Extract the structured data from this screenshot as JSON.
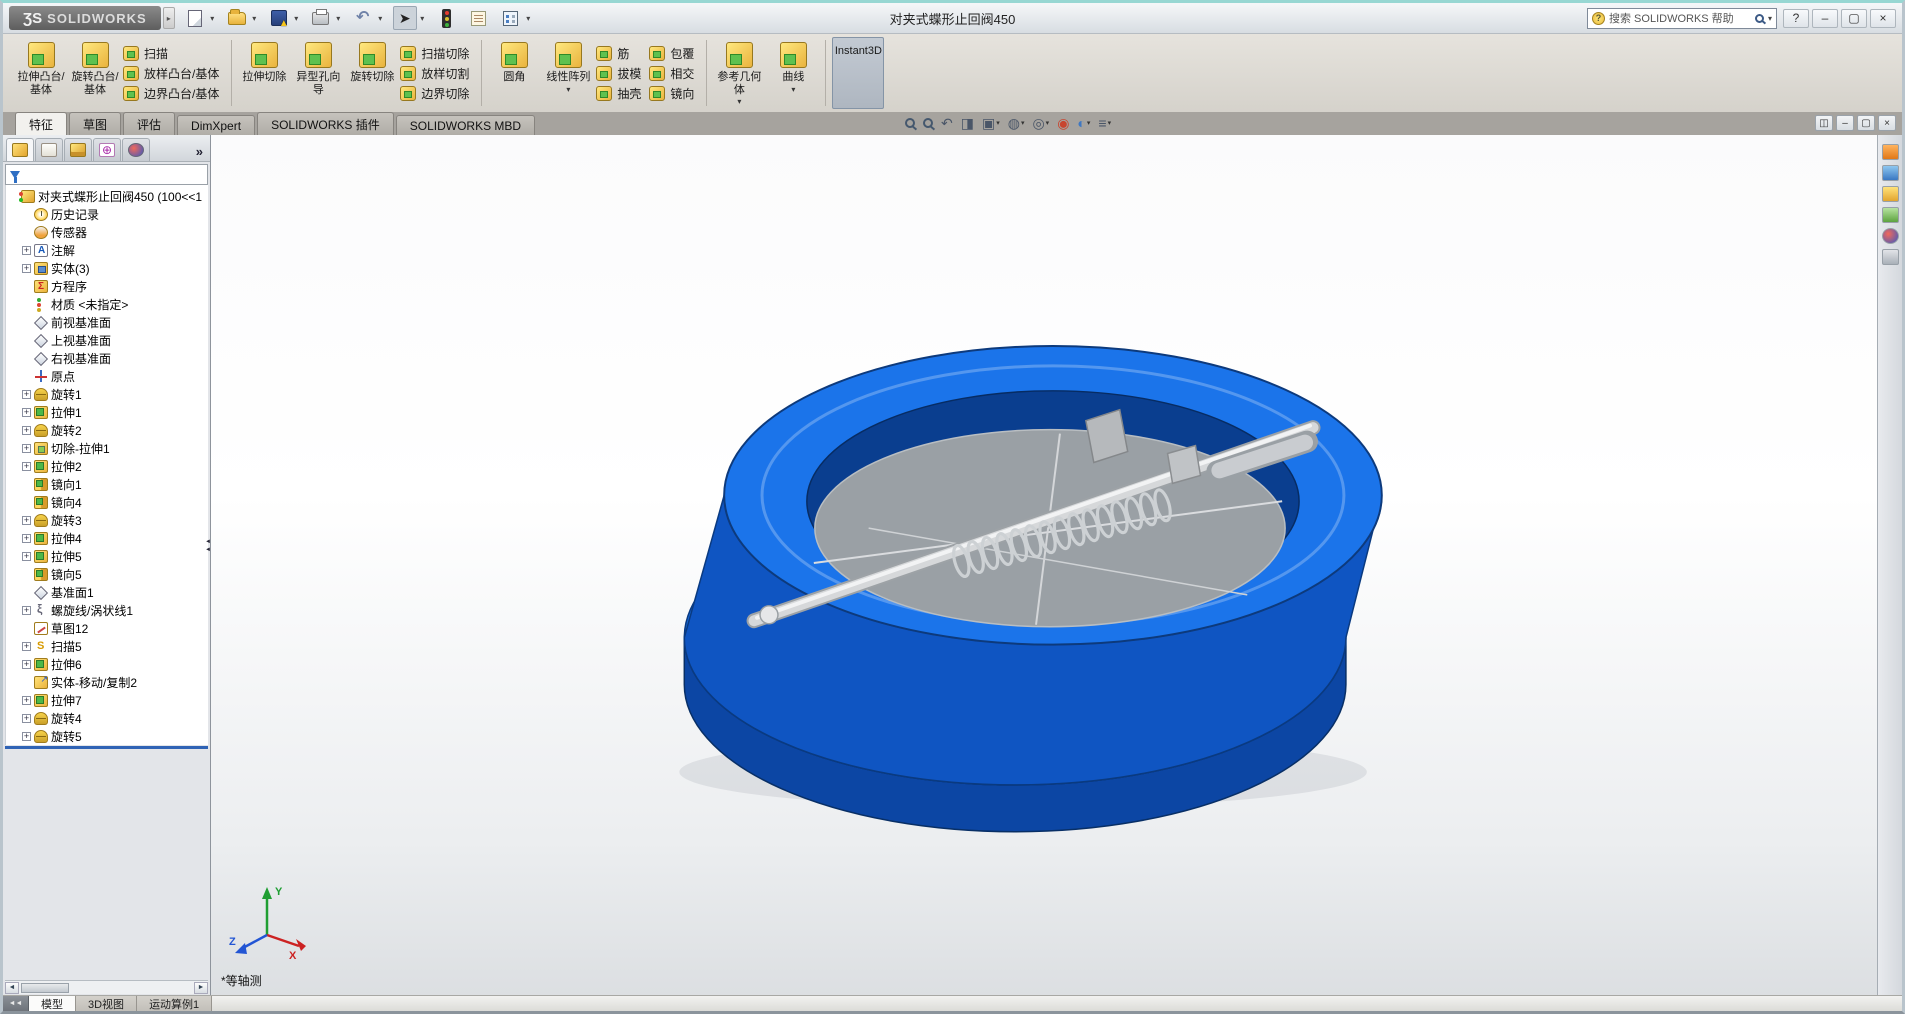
{
  "brand": {
    "mark": "ƷS",
    "name": "SOLIDWORKS"
  },
  "window": {
    "title": "对夹式蝶形止回阀450",
    "buttons": [
      "help",
      "minimize",
      "maximize",
      "close"
    ]
  },
  "search": {
    "placeholder_text": "搜索 SOLIDWORKS 帮助"
  },
  "title_toolbar": {
    "buttons": [
      "new-file",
      "open-file",
      "save-file",
      "print",
      "undo",
      "select",
      "rebuild-traffic-light",
      "file-properties",
      "options"
    ]
  },
  "ribbon": {
    "groups": [
      {
        "big": [
          {
            "name": "extrude-boss",
            "icon": "extrude-boss",
            "label": "拉伸凸台/基体"
          },
          {
            "name": "revolve-boss",
            "icon": "revolve-boss",
            "label": "旋转凸台/基体"
          }
        ],
        "cols": [
          [
            {
              "name": "sweep",
              "label": "扫描"
            },
            {
              "name": "loft-boss",
              "label": "放样凸台/基体"
            },
            {
              "name": "boundary-boss",
              "label": "边界凸台/基体"
            }
          ]
        ]
      },
      {
        "big": [
          {
            "name": "extrude-cut",
            "label": "拉伸切除"
          },
          {
            "name": "hole-wizard",
            "label": "异型孔向导"
          },
          {
            "name": "revolve-cut",
            "label": "旋转切除"
          }
        ],
        "cols": [
          [
            {
              "name": "sweep-cut",
              "label": "扫描切除"
            },
            {
              "name": "loft-cut",
              "label": "放样切割"
            },
            {
              "name": "boundary-cut",
              "label": "边界切除"
            }
          ]
        ]
      },
      {
        "big": [
          {
            "name": "fillet",
            "label": "圆角"
          },
          {
            "name": "linear-pattern",
            "label": "线性阵列",
            "dropdown": true
          }
        ],
        "cols": [
          [
            {
              "name": "rib",
              "label": "筋"
            },
            {
              "name": "draft",
              "label": "拔模"
            },
            {
              "name": "shell",
              "label": "抽壳"
            }
          ],
          [
            {
              "name": "wrap",
              "label": "包覆"
            },
            {
              "name": "intersect",
              "label": "相交"
            },
            {
              "name": "mirror",
              "label": "镜向"
            }
          ]
        ]
      },
      {
        "big": [
          {
            "name": "reference-geometry",
            "label": "参考几何体",
            "dropdown": true
          },
          {
            "name": "curves",
            "label": "曲线",
            "dropdown": true
          }
        ],
        "cols": []
      },
      {
        "big": [
          {
            "name": "instant3d",
            "label": "Instant3D",
            "pressed": true
          }
        ],
        "cols": []
      }
    ]
  },
  "tab_bar": {
    "tabs": [
      {
        "name": "features",
        "label": "特征",
        "active": true
      },
      {
        "name": "sketch",
        "label": "草图"
      },
      {
        "name": "evaluate",
        "label": "评估"
      },
      {
        "name": "dimxpert",
        "label": "DimXpert"
      },
      {
        "name": "solidworks-addins",
        "label": "SOLIDWORKS 插件"
      },
      {
        "name": "solidworks-mbd",
        "label": "SOLIDWORKS MBD"
      }
    ]
  },
  "view_toolbar": {
    "items": [
      {
        "name": "zoom-fit"
      },
      {
        "name": "zoom-area"
      },
      {
        "name": "previous-view"
      },
      {
        "name": "section-view"
      },
      {
        "name": "view-orientation",
        "dropdown": true
      },
      {
        "name": "display-style",
        "dropdown": true
      },
      {
        "name": "hide-show-items",
        "dropdown": true
      },
      {
        "name": "edit-appearance"
      },
      {
        "name": "apply-scene",
        "dropdown": true
      },
      {
        "name": "view-settings",
        "dropdown": true
      }
    ]
  },
  "document_window": {
    "buttons": [
      "split",
      "minimize",
      "restore",
      "close"
    ]
  },
  "feature_panel": {
    "manager_tabs": [
      "featuremanager-tree",
      "propertymanager",
      "configurationmanager",
      "dimxpertmanager",
      "displaymanager"
    ],
    "more_label": "»",
    "tree": {
      "items": [
        {
          "label": "对夹式蝶形止回阀450  (100<<1",
          "icon": "part",
          "root": true
        },
        {
          "label": "历史记录",
          "icon": "history"
        },
        {
          "label": "传感器",
          "icon": "sensor"
        },
        {
          "label": "注解",
          "icon": "annotations",
          "plus": true
        },
        {
          "label": "实体(3)",
          "icon": "solids",
          "plus": true
        },
        {
          "label": "方程序",
          "icon": "equations"
        },
        {
          "label": "材质 <未指定>",
          "icon": "material"
        },
        {
          "label": "前视基准面",
          "icon": "plane"
        },
        {
          "label": "上视基准面",
          "icon": "plane"
        },
        {
          "label": "右视基准面",
          "icon": "plane"
        },
        {
          "label": "原点",
          "icon": "origin"
        },
        {
          "label": "旋转1",
          "icon": "revolve",
          "plus": true
        },
        {
          "label": "拉伸1",
          "icon": "extrude",
          "plus": true
        },
        {
          "label": "旋转2",
          "icon": "revolve",
          "plus": true
        },
        {
          "label": "切除-拉伸1",
          "icon": "cut",
          "plus": true
        },
        {
          "label": "拉伸2",
          "icon": "extrude",
          "plus": true
        },
        {
          "label": "镜向1",
          "icon": "mirror"
        },
        {
          "label": "镜向4",
          "icon": "mirror"
        },
        {
          "label": "旋转3",
          "icon": "revolve",
          "plus": true
        },
        {
          "label": "拉伸4",
          "icon": "extrude",
          "plus": true
        },
        {
          "label": "拉伸5",
          "icon": "extrude",
          "plus": true
        },
        {
          "label": "镜向5",
          "icon": "mirror"
        },
        {
          "label": "基准面1",
          "icon": "plane"
        },
        {
          "label": "螺旋线/涡状线1",
          "icon": "helix",
          "plus": true
        },
        {
          "label": "草图12",
          "icon": "sketch"
        },
        {
          "label": "扫描5",
          "icon": "sweep",
          "plus": true
        },
        {
          "label": "拉伸6",
          "icon": "extrude",
          "plus": true
        },
        {
          "label": "实体-移动/复制2",
          "icon": "move"
        },
        {
          "label": "拉伸7",
          "icon": "extrude",
          "plus": true
        },
        {
          "label": "旋转4",
          "icon": "revolve",
          "plus": true
        },
        {
          "label": "旋转5",
          "icon": "revolve",
          "plus": true
        }
      ]
    }
  },
  "graphics": {
    "view_label": "*等轴测",
    "triad": {
      "x": "X",
      "y": "Y",
      "z": "Z"
    },
    "model_colors": {
      "body_top": "#1b74ea",
      "body_side": "#0f55c2",
      "bore": "#0a3e8f",
      "disc": "#9aa0a5",
      "shaft": "#d6d8da"
    }
  },
  "task_pane": {
    "icons": [
      "solidworks-resources-icon",
      "design-library-icon",
      "file-explorer-icon",
      "view-palette-icon",
      "appearances-scenes-icon",
      "custom-properties-icon"
    ]
  },
  "bottom_bar": {
    "tabs": [
      {
        "name": "model",
        "label": "模型",
        "active": true
      },
      {
        "name": "3d-views",
        "label": "3D视图"
      },
      {
        "name": "motion-study-1",
        "label": "运动算例1"
      }
    ]
  }
}
